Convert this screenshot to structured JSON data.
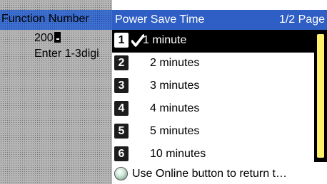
{
  "left_panel": {
    "header": "Function Number",
    "value": "200",
    "hint": "Enter 1-3digi"
  },
  "dialog": {
    "title": "Power Save Time",
    "page": "1/2 Page",
    "options": [
      {
        "number": "1",
        "label": "1 minute",
        "selected": true
      },
      {
        "number": "2",
        "label": "2 minutes",
        "selected": false
      },
      {
        "number": "3",
        "label": "3 minutes",
        "selected": false
      },
      {
        "number": "4",
        "label": "4 minutes",
        "selected": false
      },
      {
        "number": "5",
        "label": "5 minutes",
        "selected": false
      },
      {
        "number": "6",
        "label": "10 minutes",
        "selected": false
      }
    ],
    "footer": "Use Online button to return t…"
  },
  "colors": {
    "header_blue": "#2f5fc4",
    "scroll_thumb": "#fff16b",
    "selected_bg": "#000000"
  },
  "icons": {
    "selected_mark": "checkmark-icon",
    "online": "online-button-icon",
    "cursor": "enter-cursor-icon"
  }
}
